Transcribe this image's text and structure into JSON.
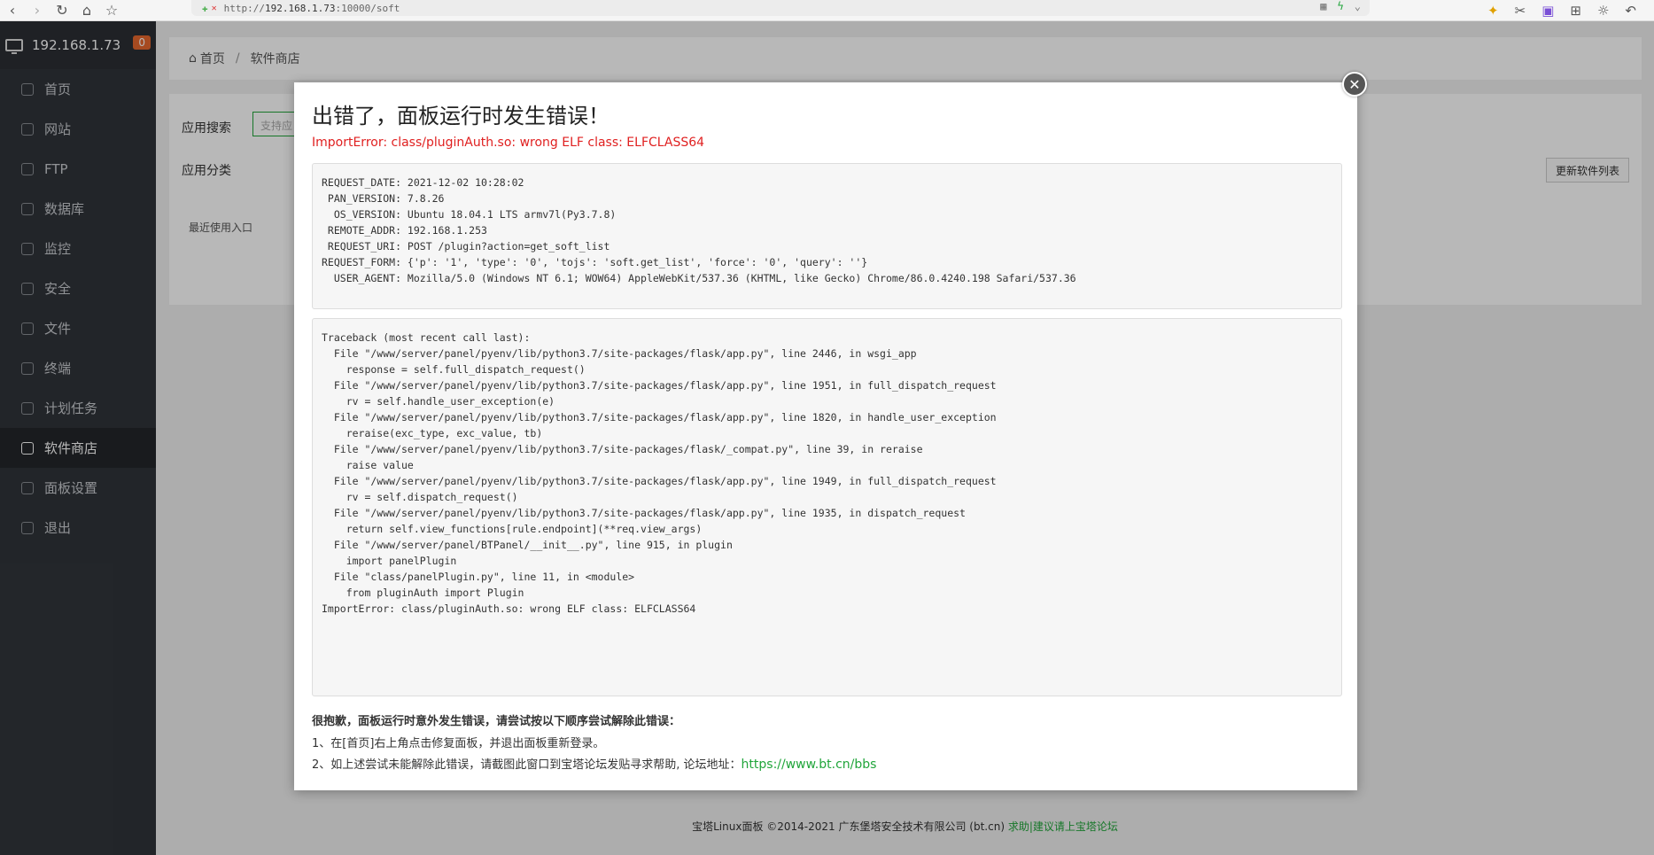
{
  "browser": {
    "url_scheme": "http://",
    "url_host": "192.168.1.73",
    "url_path": ":10000/soft"
  },
  "sidebar": {
    "host": "192.168.1.73",
    "badge": "0",
    "items": [
      {
        "label": "首页"
      },
      {
        "label": "网站"
      },
      {
        "label": "FTP"
      },
      {
        "label": "数据库"
      },
      {
        "label": "监控"
      },
      {
        "label": "安全"
      },
      {
        "label": "文件"
      },
      {
        "label": "终端"
      },
      {
        "label": "计划任务"
      },
      {
        "label": "软件商店"
      },
      {
        "label": "面板设置"
      },
      {
        "label": "退出"
      }
    ]
  },
  "breadcrumb": {
    "home": "首页",
    "sep": "/",
    "current": "软件商店"
  },
  "panel": {
    "search_label": "应用搜索",
    "search_placeholder": "支持应",
    "category_label": "应用分类",
    "refresh_button": "更新软件列表",
    "recent_label": "最近使用入口"
  },
  "footer": {
    "copyright": "宝塔Linux面板 ©2014-2021 广东堡塔安全技术有限公司 (bt.cn)",
    "help": "求助|建议请上宝塔论坛"
  },
  "modal": {
    "title": "出错了，面板运行时发生错误！",
    "error": "ImportError: class/pluginAuth.so: wrong ELF class: ELFCLASS64",
    "request_info": "REQUEST_DATE: 2021-12-02 10:28:02\n PAN_VERSION: 7.8.26\n  OS_VERSION: Ubuntu 18.04.1 LTS armv7l(Py3.7.8)\n REMOTE_ADDR: 192.168.1.253\n REQUEST_URI: POST /plugin?action=get_soft_list\nREQUEST_FORM: {'p': '1', 'type': '0', 'tojs': 'soft.get_list', 'force': '0', 'query': ''}\n  USER_AGENT: Mozilla/5.0 (Windows NT 6.1; WOW64) AppleWebKit/537.36 (KHTML, like Gecko) Chrome/86.0.4240.198 Safari/537.36",
    "traceback": "Traceback (most recent call last):\n  File \"/www/server/panel/pyenv/lib/python3.7/site-packages/flask/app.py\", line 2446, in wsgi_app\n    response = self.full_dispatch_request()\n  File \"/www/server/panel/pyenv/lib/python3.7/site-packages/flask/app.py\", line 1951, in full_dispatch_request\n    rv = self.handle_user_exception(e)\n  File \"/www/server/panel/pyenv/lib/python3.7/site-packages/flask/app.py\", line 1820, in handle_user_exception\n    reraise(exc_type, exc_value, tb)\n  File \"/www/server/panel/pyenv/lib/python3.7/site-packages/flask/_compat.py\", line 39, in reraise\n    raise value\n  File \"/www/server/panel/pyenv/lib/python3.7/site-packages/flask/app.py\", line 1949, in full_dispatch_request\n    rv = self.dispatch_request()\n  File \"/www/server/panel/pyenv/lib/python3.7/site-packages/flask/app.py\", line 1935, in dispatch_request\n    return self.view_functions[rule.endpoint](**req.view_args)\n  File \"/www/server/panel/BTPanel/__init__.py\", line 915, in plugin\n    import panelPlugin\n  File \"class/panelPlugin.py\", line 11, in <module>\n    from pluginAuth import Plugin\nImportError: class/pluginAuth.so: wrong ELF class: ELFCLASS64",
    "tip_title": "很抱歉，面板运行时意外发生错误，请尝试按以下顺序尝试解除此错误：",
    "tip1": "1、在[首页]右上角点击修复面板，并退出面板重新登录。",
    "tip2": "2、如上述尝试未能解除此错误，请截图此窗口到宝塔论坛发贴寻求帮助, 论坛地址：",
    "forum_link": "https://www.bt.cn/bbs"
  }
}
